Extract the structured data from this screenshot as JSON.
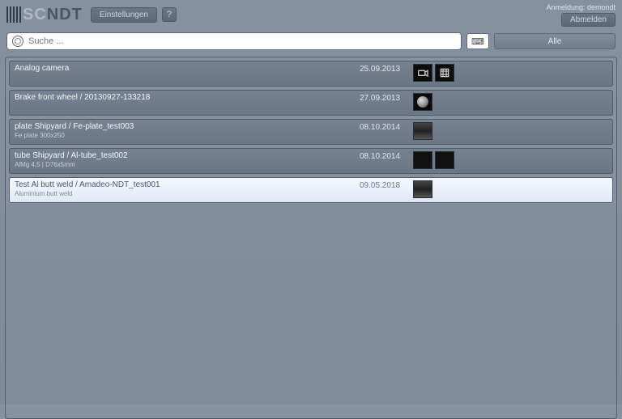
{
  "header": {
    "logo_left": "SC",
    "logo_right": "NDT",
    "settings": "Einstellungen",
    "help": "?",
    "login_label": "Anmeldung: demondt",
    "logout": "Abmelden"
  },
  "search": {
    "placeholder": "Suche ...",
    "keyboard_icon_label": "⌨",
    "filter_all": "Alle"
  },
  "rows": [
    {
      "title": "Analog camera",
      "date": "25.09.2013",
      "subtitle": "",
      "thumbs": [
        "cam",
        "film"
      ],
      "selected": false
    },
    {
      "title": "Brake front wheel / 20130927-133218",
      "date": "27.09.2013",
      "subtitle": "",
      "thumbs": [
        "disc"
      ],
      "selected": false
    },
    {
      "title": "plate Shipyard / Fe-plate_test003",
      "date": "08.10.2014",
      "subtitle": "Fe plate 300x250",
      "thumbs": [
        "grad"
      ],
      "selected": false
    },
    {
      "title": "tube Shipyard / Al-tube_test002",
      "date": "08.10.2014",
      "subtitle": "AlMg 4,5 | D76x5mm",
      "thumbs": [
        "bars",
        "bars"
      ],
      "selected": false
    },
    {
      "title": "Test Al butt weld / Amadeo-NDT_test001",
      "date": "09.05.2018",
      "subtitle": "Aluminium butt weld",
      "thumbs": [
        "grad"
      ],
      "selected": true
    }
  ]
}
